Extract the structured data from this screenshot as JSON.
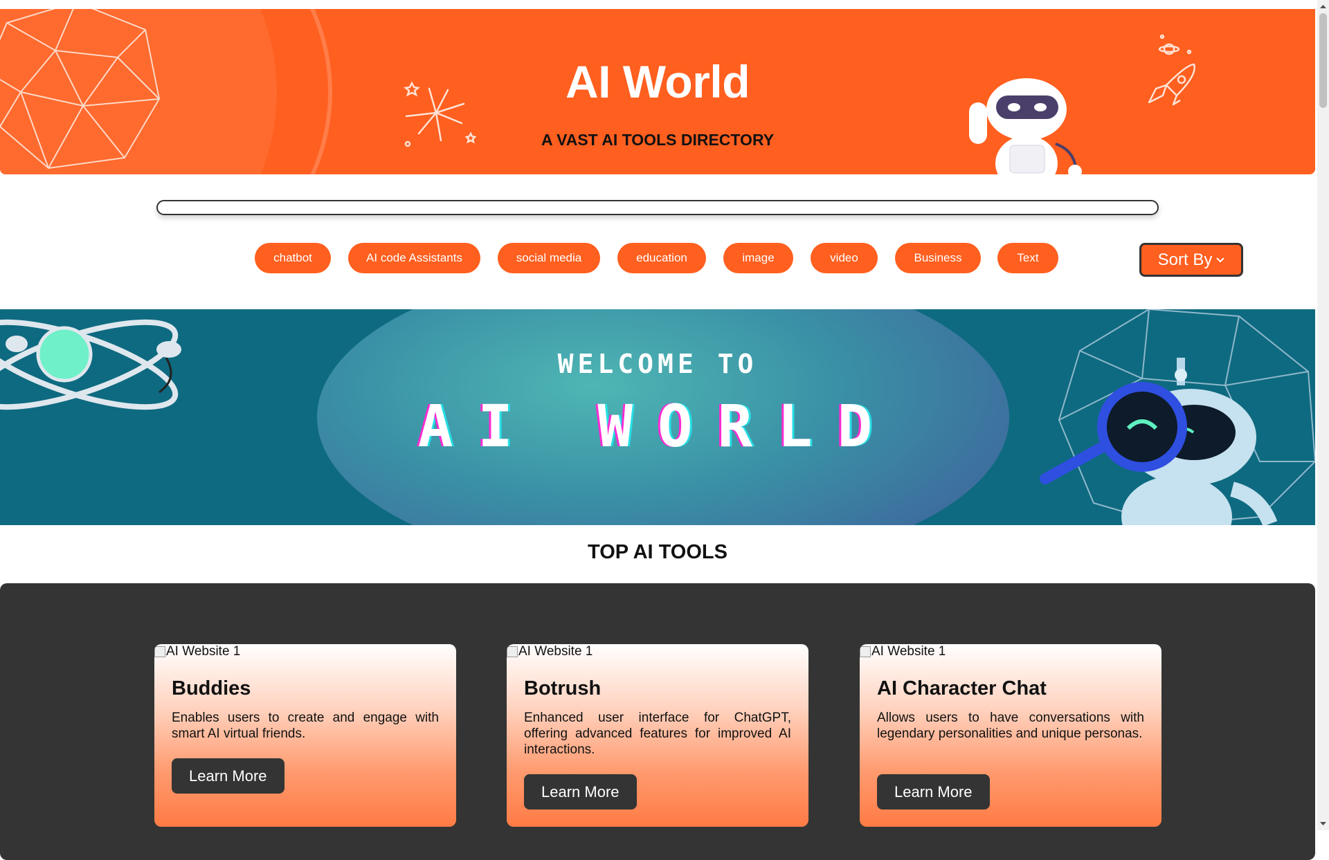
{
  "header": {
    "title": "AI World",
    "subtitle": "A VAST AI TOOLS DIRECTORY"
  },
  "search": {
    "placeholder": "",
    "value": ""
  },
  "categories": [
    "chatbot",
    "AI code Assistants",
    "social media",
    "education",
    "image",
    "video",
    "Business",
    "Text"
  ],
  "sort": {
    "label": "Sort By"
  },
  "banner": {
    "welcome": "WELCOME TO",
    "title": "AI WORLD"
  },
  "section_title": "TOP AI TOOLS",
  "cards": [
    {
      "img_alt": "AI Website 1",
      "name": "Buddies",
      "description": "Enables users to create and engage with smart AI virtual friends.",
      "button": "Learn More"
    },
    {
      "img_alt": "AI Website 1",
      "name": "Botrush",
      "description": "Enhanced user interface for ChatGPT, offering advanced features for improved AI interactions.",
      "button": "Learn More"
    },
    {
      "img_alt": "AI Website 1",
      "name": "AI Character Chat",
      "description": "Allows users to have conversations with legendary personalities and unique personas.",
      "button": "Learn More"
    }
  ],
  "colors": {
    "accent": "#ff5f1f",
    "banner": "#0e6a80",
    "dark": "#333433"
  },
  "icons": [
    "geodesic-sphere-icon",
    "sparkle-icon",
    "robot-icon",
    "rocket-icon",
    "atom-icon",
    "robot-magnifier-icon",
    "chevron-down-icon"
  ]
}
